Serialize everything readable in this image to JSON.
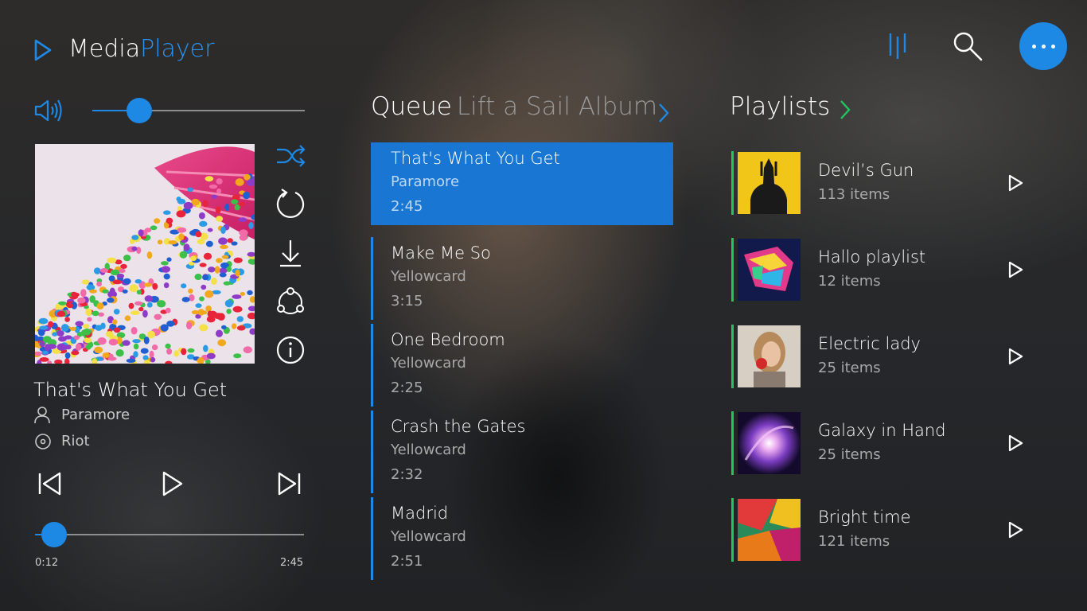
{
  "app": {
    "title_main": "Media",
    "title_accent": "Player"
  },
  "now_playing": {
    "title": "That's What You Get",
    "artist": "Paramore",
    "album": "Riot",
    "elapsed": "0:12",
    "duration": "2:45",
    "progress_fraction": 0.07,
    "volume_fraction": 0.22
  },
  "queue": {
    "heading": "Queue",
    "subheading": "Lift a Sail Album",
    "items": [
      {
        "title": "That's What You Get",
        "artist": "Paramore",
        "time": "2:45"
      },
      {
        "title": "Make Me So",
        "artist": "Yellowcard",
        "time": "3:15"
      },
      {
        "title": "One Bedroom",
        "artist": "Yellowcard",
        "time": "2:25"
      },
      {
        "title": "Crash the Gates",
        "artist": "Yellowcard",
        "time": "2:32"
      },
      {
        "title": "Madrid",
        "artist": "Yellowcard",
        "time": "2:51"
      }
    ]
  },
  "playlists": {
    "heading": "Playlists",
    "items": [
      {
        "name": "Devil’s Gun",
        "count": "113 items"
      },
      {
        "name": "Hallo playlist",
        "count": "12 items"
      },
      {
        "name": "Electric lady",
        "count": "25 items"
      },
      {
        "name": "Galaxy in Hand",
        "count": "25 items"
      },
      {
        "name": "Bright time",
        "count": "121 items"
      }
    ]
  },
  "colors": {
    "accent": "#1e88e5",
    "active_row": "#1976d2",
    "playlist_bar": "#22c55e"
  },
  "icons": {
    "header": [
      "play-logo-icon",
      "equalizer-icon",
      "search-icon",
      "more-icon"
    ],
    "side": [
      "shuffle-icon",
      "repeat-icon",
      "download-icon",
      "share-icon",
      "info-icon"
    ],
    "controls": [
      "previous-icon",
      "play-icon",
      "next-icon"
    ]
  }
}
